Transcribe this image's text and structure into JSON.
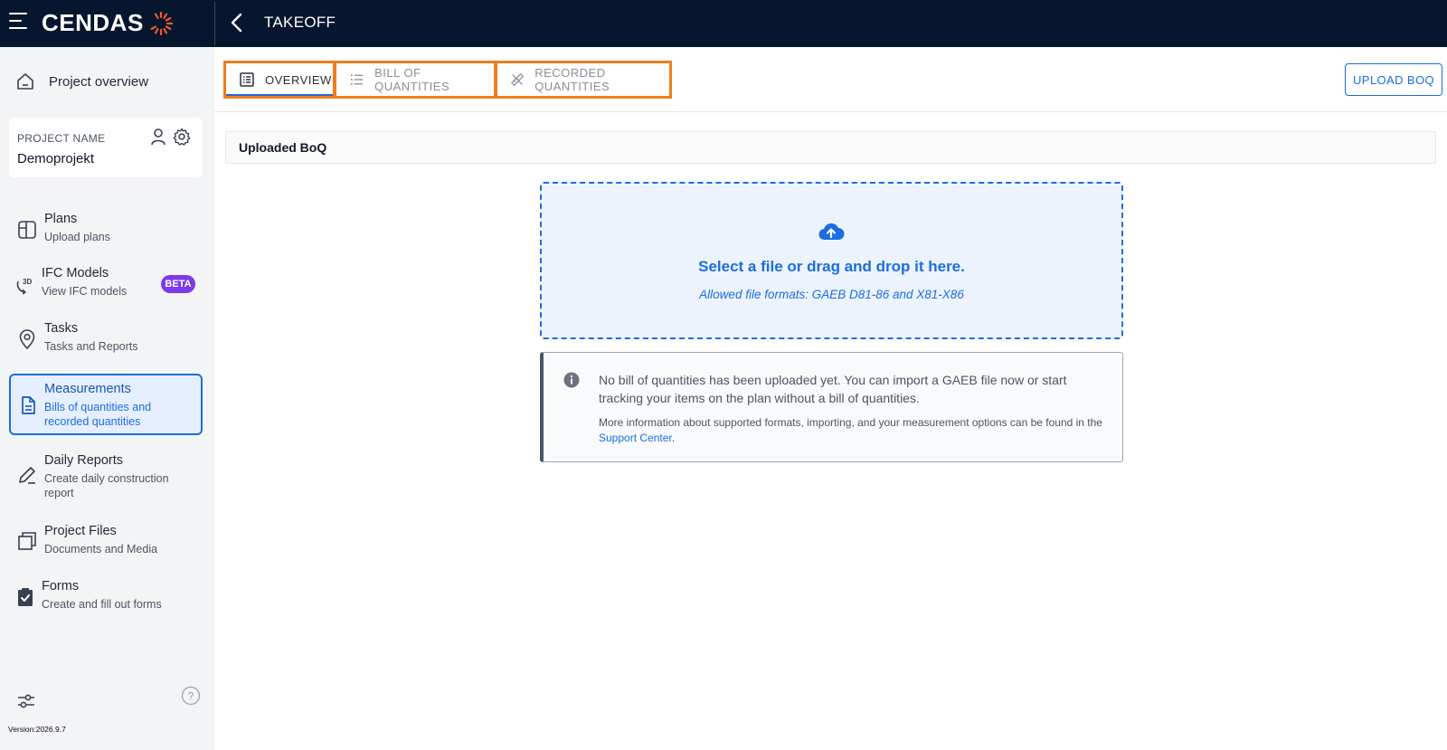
{
  "topbar": {
    "logo_text": "CENDAS",
    "title": "TAKEOFF"
  },
  "sidebar": {
    "overview_label": "Project overview",
    "project": {
      "label": "PROJECT NAME",
      "name": "Demoprojekt"
    },
    "items": [
      {
        "title": "Plans",
        "subtitle": "Upload plans",
        "icon": "plans-icon"
      },
      {
        "title": "IFC Models",
        "subtitle": "View IFC models",
        "icon": "3d-rotate-icon",
        "badge": "BETA"
      },
      {
        "title": "Tasks",
        "subtitle": "Tasks and Reports",
        "icon": "location-pin-icon"
      },
      {
        "title": "Measurements",
        "subtitle": "Bills of quantities and recorded quantities",
        "icon": "document-icon",
        "active": true
      },
      {
        "title": "Daily Reports",
        "subtitle": "Create daily construction report",
        "icon": "pencil-icon"
      },
      {
        "title": "Project Files",
        "subtitle": "Documents and Media",
        "icon": "copy-files-icon"
      },
      {
        "title": "Forms",
        "subtitle": "Create and fill out forms",
        "icon": "clipboard-check-icon"
      }
    ],
    "version": "Version:2026.9.7"
  },
  "tabs": [
    {
      "label": "OVERVIEW",
      "active": true
    },
    {
      "label": "BILL OF QUANTITIES",
      "active": false
    },
    {
      "label": "RECORDED QUANTITIES",
      "active": false
    }
  ],
  "upload_button": "UPLOAD BOQ",
  "section_title": "Uploaded BoQ",
  "dropzone": {
    "title": "Select a file or drag and drop it here.",
    "subtitle": "Allowed file formats: GAEB D81-86 and X81-X86"
  },
  "info": {
    "main": "No bill of quantities has been uploaded yet. You can import a GAEB file now or start tracking your items on the plan without a bill of quantities.",
    "secondary": "More information about supported formats, importing, and your measurement options can be found in the",
    "link": "Support Center",
    "link_suffix": "."
  },
  "colors": {
    "topbar": "#05162e",
    "accent": "#1a6ee0",
    "tab_highlight": "#f07d1e",
    "beta": "#7c3aed"
  }
}
